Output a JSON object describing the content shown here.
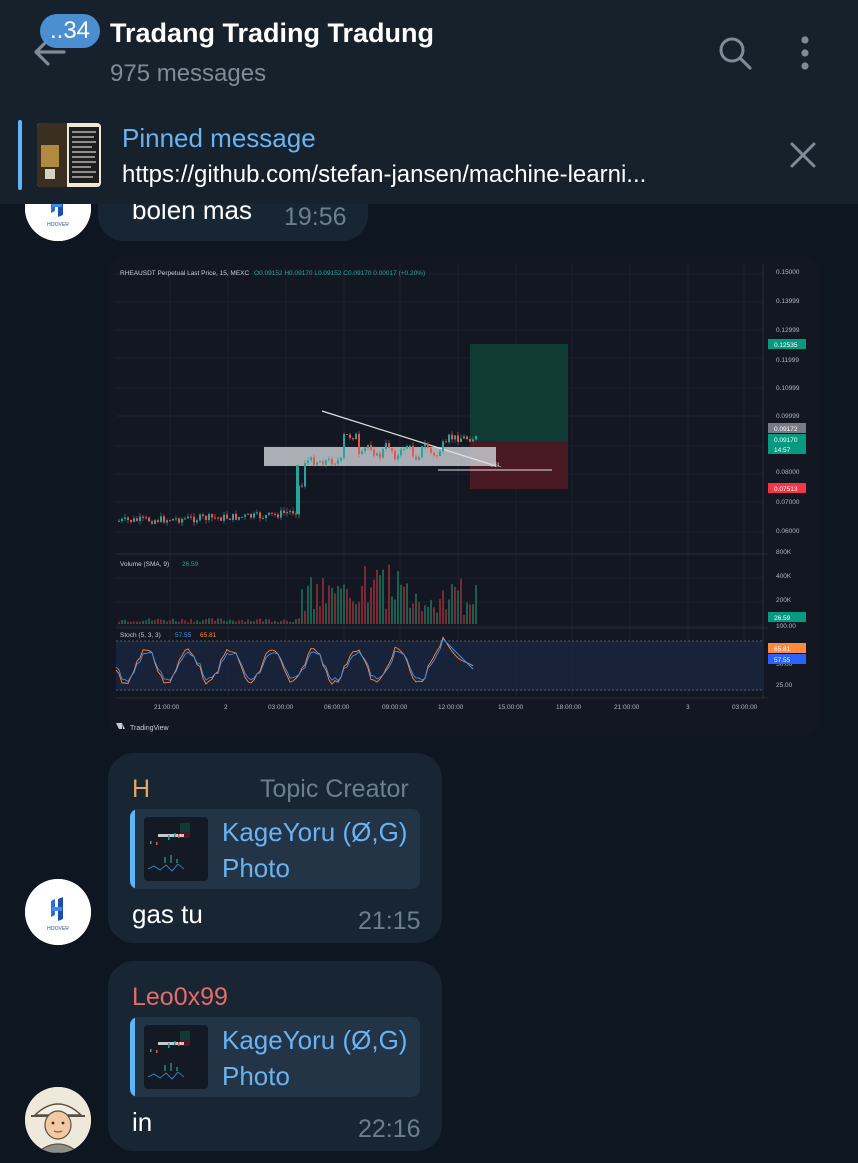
{
  "header": {
    "unread_count": "..34",
    "title": "Tradang Trading Tradung",
    "subtitle": "975 messages"
  },
  "pinned": {
    "label": "Pinned message",
    "text": "https://github.com/stefan-jansen/machine-learni..."
  },
  "messages": [
    {
      "text": "bolen mas",
      "time": "19:56",
      "avatar_label": "HOOVER"
    },
    {
      "type": "photo",
      "chart": {
        "title_line": "RHEAUSDT Perpetual Last Price, 15, MEXC",
        "ohlc": "O0.09152 H0.09170 L0.09152 C0.09170 0.00017 (+0.20%)",
        "price_ticks": [
          "0.15000",
          "0.13999",
          "0.12999",
          "0.11999",
          "0.10999",
          "0.09999",
          "0.08000",
          "0.07000",
          "0.06000"
        ],
        "price_badges": [
          "0.12535",
          "0.09172",
          "0.09170",
          "14:57",
          "0.07513"
        ],
        "volume_label": "Volume (SMA, 9)",
        "volume_value": "26.59",
        "volume_ticks": [
          "800K",
          "400K",
          "200K"
        ],
        "volume_badge": "26.59",
        "stoch_label": "Stoch (5, 3, 3)",
        "stoch_k": "57.55",
        "stoch_d": "65.81",
        "stoch_ticks": [
          "100.00",
          "50.00",
          "25.00"
        ],
        "stoch_badges": [
          "65.81",
          "57.55"
        ],
        "time_ticks": [
          "21:00:00",
          "2",
          "03:00:00",
          "06:00:00",
          "09:00:00",
          "12:00:00",
          "15:00:00",
          "18:00:00",
          "21:00:00",
          "3",
          "03:00:00"
        ],
        "sl_label": "SSL",
        "brand": "TradingView"
      }
    },
    {
      "sender": "H",
      "sender_color": "#e5a464",
      "role": "Topic Creator",
      "reply_name": "KageYoru (Ø,G)",
      "reply_type": "Photo",
      "text": "gas tu",
      "time": "21:15",
      "avatar_label": "HOOVER"
    },
    {
      "sender": "Leo0x99",
      "sender_color": "#e66b6b",
      "reply_name": "KageYoru (Ø,G)",
      "reply_type": "Photo",
      "text": "in",
      "time": "22:16"
    }
  ],
  "colors": {
    "background": "#0e1621",
    "header": "#17212b",
    "bubble": "#182533",
    "accent": "#6ab3f3",
    "badge": "#4c8fd0"
  },
  "icons": [
    "back-arrow-icon",
    "search-icon",
    "more-vertical-icon",
    "close-icon",
    "hoover-logo-icon",
    "user-avatar-icon"
  ]
}
